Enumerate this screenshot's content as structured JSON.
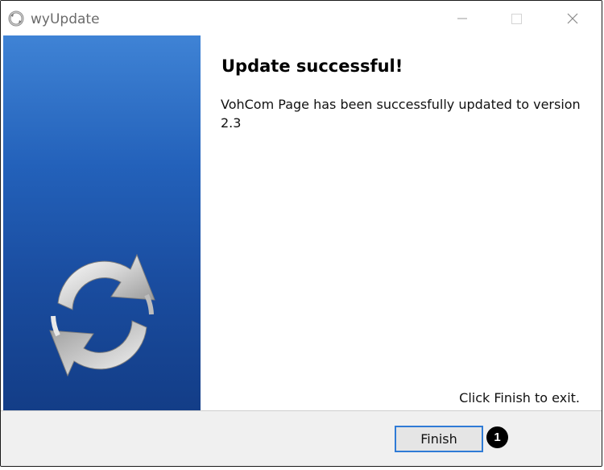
{
  "window": {
    "title": "wyUpdate",
    "icons": {
      "app": "sync-arrows-icon",
      "minimize": "minimize-icon",
      "maximize": "maximize-icon",
      "close": "close-icon"
    }
  },
  "sidebar": {
    "logo": "sync-arrows-logo",
    "gradient_top": "#3f83d5",
    "gradient_bottom": "#133d87"
  },
  "content": {
    "heading": "Update successful!",
    "message": "VohCom Page has been successfully updated to version 2.3",
    "exit_hint": "Click Finish to exit."
  },
  "footer": {
    "finish_label": "Finish",
    "step_badge": "1",
    "accent": "#2f7bd6"
  }
}
